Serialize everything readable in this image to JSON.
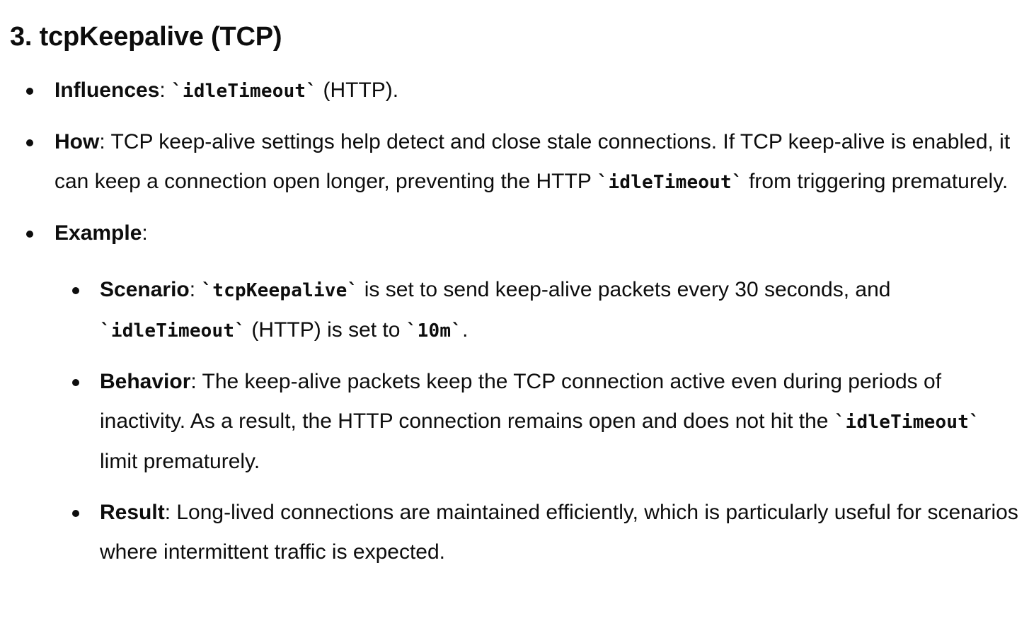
{
  "heading": "3. tcpKeepalive (TCP)",
  "items": [
    {
      "label": "Influences",
      "parts": [
        ": ",
        "`idleTimeout`",
        " (HTTP)."
      ]
    },
    {
      "label": "How",
      "parts": [
        ": TCP keep-alive settings help detect and close stale connections. If TCP keep-alive is enabled, it can keep a connection open longer, preventing the HTTP ",
        "`idleTimeout`",
        " from triggering prematurely."
      ]
    },
    {
      "label": "Example",
      "tail": ":",
      "subitems": [
        {
          "label": "Scenario",
          "parts": [
            ": ",
            "`tcpKeepalive`",
            " is set to send keep-alive packets every 30 seconds, and ",
            "`idleTimeout`",
            " (HTTP) is set to ",
            "`10m`",
            "."
          ]
        },
        {
          "label": "Behavior",
          "parts": [
            ": The keep-alive packets keep the TCP connection active even during periods of inactivity. As a result, the HTTP connection remains open and does not hit the ",
            "`idleTimeout`",
            " limit prematurely."
          ]
        },
        {
          "label": "Result",
          "parts": [
            ": Long-lived connections are maintained efficiently, which is particularly useful for scenarios where intermittent traffic is expected."
          ]
        }
      ]
    }
  ]
}
